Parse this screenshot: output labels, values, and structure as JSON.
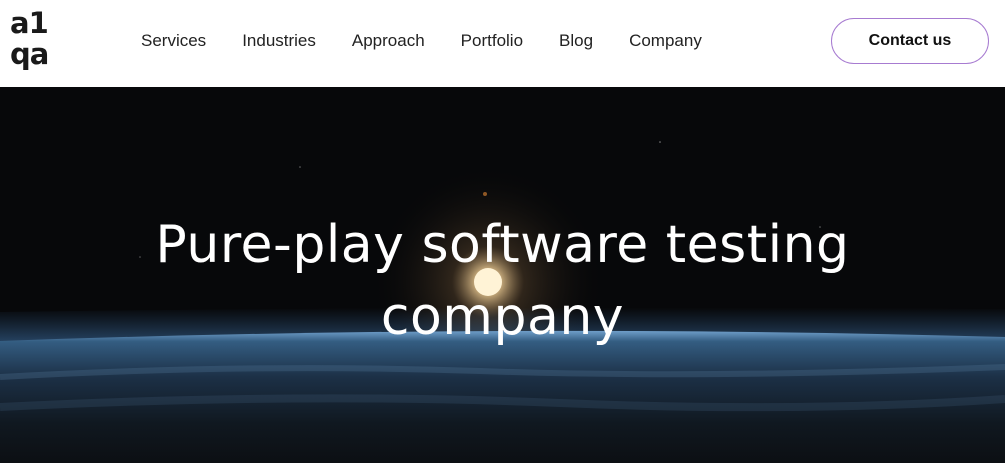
{
  "header": {
    "logo": {
      "line1": "a1",
      "line2": "qa"
    },
    "nav": [
      "Services",
      "Industries",
      "Approach",
      "Portfolio",
      "Blog",
      "Company"
    ],
    "contact_label": "Contact us",
    "accent_color": "#a77bd1"
  },
  "hero": {
    "title_line1": "Pure-play software testing",
    "title_line2": "company"
  }
}
